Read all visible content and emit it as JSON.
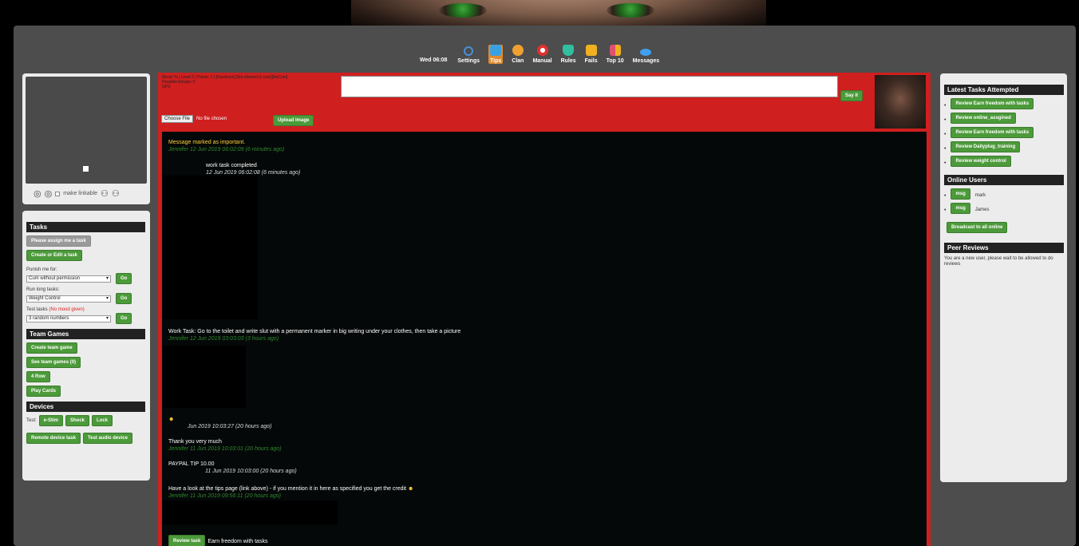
{
  "nav": {
    "time": "Wed 06:08",
    "items": [
      {
        "label": "Settings",
        "icon": "gears-icon",
        "color": "#4a90d9"
      },
      {
        "label": "Tips",
        "icon": "tips-icon",
        "color": "#3aa0e0"
      },
      {
        "label": "Clan",
        "icon": "clan-icon",
        "color": "#f0a030"
      },
      {
        "label": "Manual",
        "icon": "lifebuoy-icon",
        "color": "#e03030"
      },
      {
        "label": "Rules",
        "icon": "shield-icon",
        "color": "#30c0a0"
      },
      {
        "label": "Fails",
        "icon": "trash-icon",
        "color": "#f0b020"
      },
      {
        "label": "Top 10",
        "icon": "blocks-icon",
        "color": "#e05070"
      },
      {
        "label": "Messages",
        "icon": "chat-icon",
        "color": "#40a0f0"
      }
    ],
    "active": "Tips"
  },
  "avatar": {
    "make_linkable": "make linkable"
  },
  "tasks": {
    "header": "Tasks",
    "assign_btn": "Please assign me a task",
    "create_btn": "Create or Edit a task",
    "punish_label": "Punish me for:",
    "punish_value": "Cum without permission",
    "run_label": "Run long tasks:",
    "run_value": "Weight Control",
    "test_label": "Test tasks",
    "test_note": "(No mood given)",
    "test_value": "3 random numbers",
    "go": "Go"
  },
  "team": {
    "header": "Team Games",
    "create": "Create team game",
    "see": "See team games (0)",
    "row4": "4 Row",
    "cards": "Play Cards"
  },
  "devices": {
    "header": "Devices",
    "test_label": "Test:",
    "buttons": [
      "e-Stim",
      "Shock",
      "Lock"
    ],
    "remote": "Remote device task",
    "audio": "Test audio device"
  },
  "center": {
    "info_line1": "Mood:     % | Level 2 | Points: 1 | [Hardcore] [Not allowed to cum][NoCum]",
    "info_line2": "Possible linkups: 0",
    "info_line3": "GPS",
    "say_it": "Say it",
    "choose_file": "Choose File",
    "no_file": "No file chosen",
    "upload": "Upload Image"
  },
  "chat": {
    "m1_text": "Message marked as important.",
    "m1_meta": "Jennifer 12 Jun 2019 06:02:09 (6 minutes ago)",
    "m2_text": "work task completed",
    "m2_meta": "12 Jun 2019 06:02:08 (6 minutes ago)",
    "m3_text": "Work Task: Go to the toilet and write slut with a permanent marker in big writing under your clothes, then take a picture",
    "m3_meta": "Jennifer 12 Jun 2019 03:03:03 (3 hours ago)",
    "m4_meta": "Jun 2019 10:03:27 (20 hours ago)",
    "m5_text": "Thank you very much",
    "m5_meta": "Jennifer 11 Jun 2019 10:03:01 (20 hours ago)",
    "m6_text": "PAYPAL TIP 10.00",
    "m6_meta": "11 Jun 2019 10:03:00 (20 hours ago)",
    "m7_text": "Have a look at the tips page (link above) - if you mention it in here as specified you get the credit",
    "m7_meta": "Jennifer 11 Jun 2019 09:56:11 (20 hours ago)",
    "review_btn": "Review task",
    "review_text": "Earn freedom with tasks"
  },
  "right": {
    "latest_header": "Latest Tasks Attempted",
    "latest": [
      "Review Earn freedom with tasks",
      "Review online_assgined",
      "Review Earn freedom with tasks",
      "Review Dailyplug_training",
      "Review weight control"
    ],
    "online_header": "Online Users",
    "users": [
      {
        "btn": "msg",
        "name": "mark"
      },
      {
        "btn": "msg",
        "name": "James"
      }
    ],
    "broadcast": "Broadcast to all online",
    "peer_header": "Peer Reviews",
    "peer_text": "You are a new user, please wait to be allowed to do reviews"
  }
}
